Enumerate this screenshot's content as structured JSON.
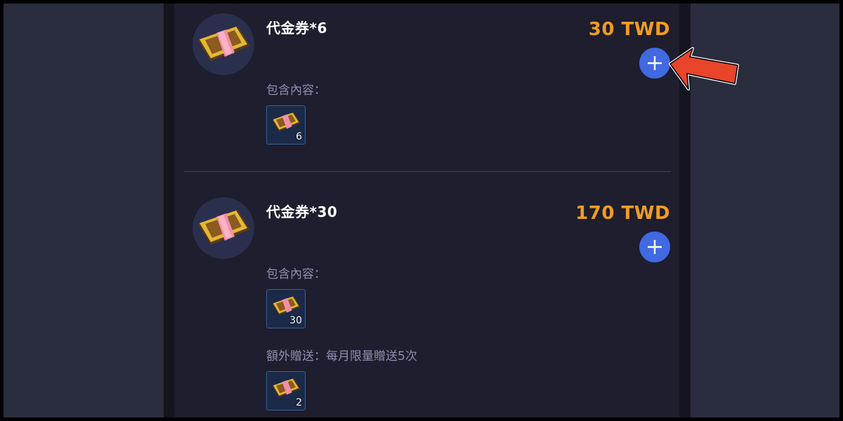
{
  "products": [
    {
      "title": "代金券*6",
      "price": "30 TWD",
      "contents_label": "包含內容：",
      "contents": [
        {
          "icon": "voucher-icon",
          "count": "6"
        }
      ]
    },
    {
      "title": "代金券*30",
      "price": "170 TWD",
      "contents_label": "包含內容：",
      "contents": [
        {
          "icon": "voucher-icon",
          "count": "30"
        }
      ],
      "bonus_label": "額外贈送：每月限量贈送5次",
      "bonus": [
        {
          "icon": "voucher-icon",
          "count": "2"
        }
      ]
    }
  ],
  "add_button_icon": "plus-icon",
  "annotation": {
    "icon": "red-arrow-icon",
    "target": "product-1 add button"
  },
  "colors": {
    "background": "#2a2d3e",
    "panel": "#1e1e2e",
    "price": "#f39c1f",
    "add_button": "#4169e1",
    "label": "#8c8fb0",
    "arrow": "#e8442a"
  }
}
